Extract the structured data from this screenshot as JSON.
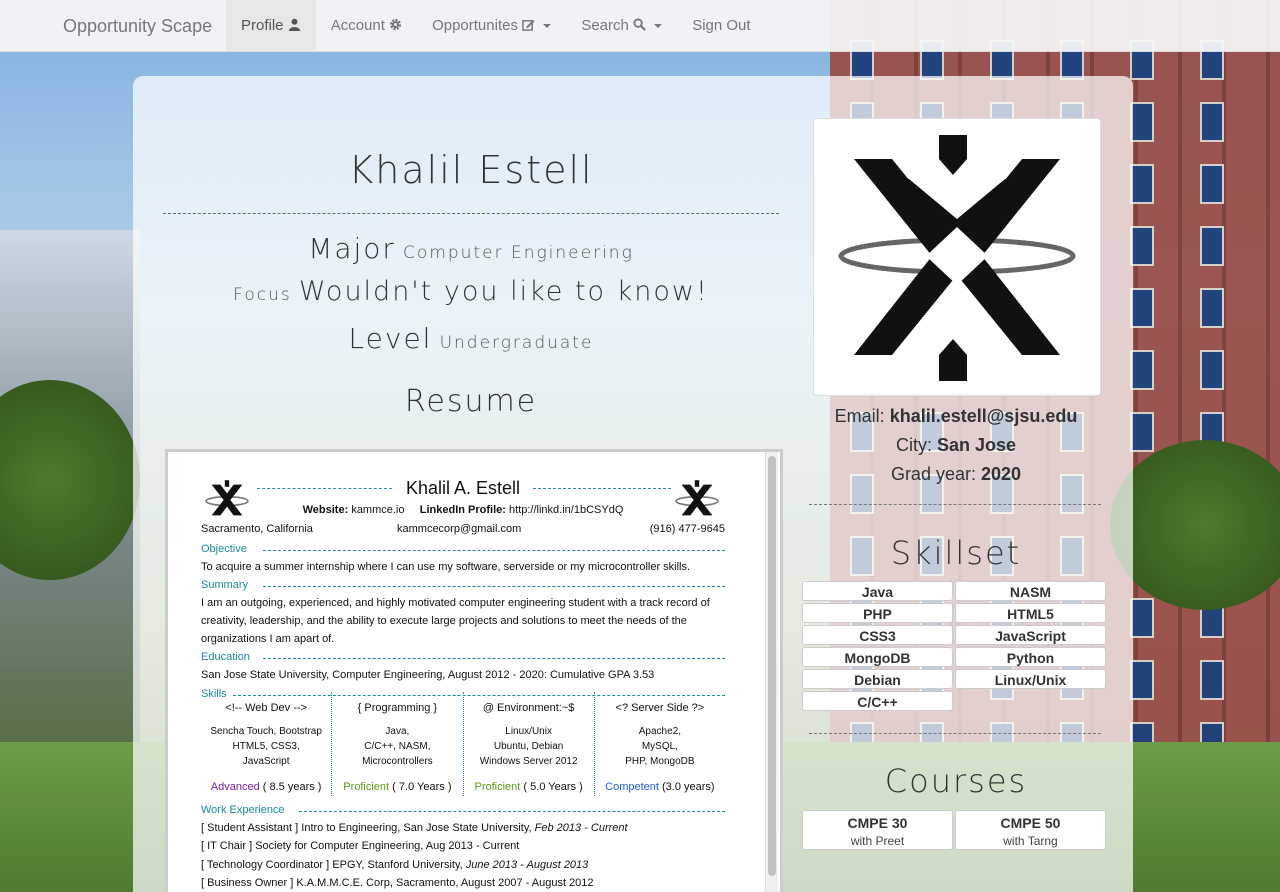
{
  "navbar": {
    "brand": "Opportunity Scape",
    "items": [
      {
        "label": "Profile",
        "icon": "user-icon",
        "active": true
      },
      {
        "label": "Account",
        "icon": "gear-icon"
      },
      {
        "label": "Opportunites",
        "icon": "edit-icon",
        "dropdown": true
      },
      {
        "label": "Search",
        "icon": "search-icon",
        "dropdown": true
      },
      {
        "label": "Sign Out"
      }
    ]
  },
  "profile": {
    "name": "Khalil Estell",
    "major_label": "Major",
    "major_value": "Computer Engineering",
    "focus_label": "Focus",
    "focus_value": "Wouldn't you like to know!",
    "level_label": "Level",
    "level_value": "Undergraduate",
    "resume_title": "Resume"
  },
  "resume": {
    "name": "Khalil A. Estell",
    "website_label": "Website:",
    "website": "kammce.io",
    "linkedin_label": "LinkedIn Profile:",
    "linkedin": "http://linkd.in/1bCSYdQ",
    "location": "Sacramento, California",
    "email": "kammcecorp@gmail.com",
    "phone": "(916) 477-9645",
    "objective_title": "Objective",
    "objective": "To acquire a summer internship where I can use my software, serverside or my microcontroller skills.",
    "summary_title": "Summary",
    "summary": "I am an outgoing, experienced, and highly motivated computer engineering student with a track record of creativity, leadership, and the ability to execute large projects and solutions to meet the needs of the organizations I am apart of.",
    "education_title": "Education",
    "education": "San Jose State University, Computer Engineering, August 2012 - 2020: Cumulative GPA 3.53",
    "skills_title": "Skills",
    "skill_columns": [
      {
        "head": "<!-- Web Dev -->",
        "items": [
          "Sencha Touch, Bootstrap",
          "HTML5, CSS3,",
          "JavaScript"
        ],
        "level": "Advanced",
        "years": "( 8.5 years )",
        "color": "#7a1fa0"
      },
      {
        "head": "{ Programming }",
        "items": [
          "Java,",
          "C/C++, NASM,",
          "Microcontrollers"
        ],
        "level": "Proficient",
        "years": "( 7.0 Years )",
        "color": "#5a9a1a"
      },
      {
        "head": "@ Environment:~$",
        "items": [
          "Linux/Unix",
          "Ubuntu, Debian",
          "Windows Server 2012"
        ],
        "level": "Proficient",
        "years": "( 5.0 Years )",
        "color": "#5a9a1a"
      },
      {
        "head": "<? Server Side ?>",
        "items": [
          "Apache2,",
          "MySQL,",
          "PHP, MongoDB"
        ],
        "level": "Competent",
        "years": "(3.0 years)",
        "color": "#1f5fd0"
      }
    ],
    "work_title": "Work Experience",
    "work": [
      {
        "role": "[ Student Assistant ]",
        "desc": " Intro to Engineering, San Jose State University, ",
        "dates": "Feb 2013 - Current"
      },
      {
        "role": "[ IT Chair ]",
        "desc": " Society for Computer Engineering, Aug 2013 - Current",
        "dates": ""
      },
      {
        "role": "[ Technology Coordinator ]",
        "desc": " EPGY, Stanford University, ",
        "dates": "June 2013 - August 2013"
      },
      {
        "role": "[ Business Owner ]",
        "desc": " K.A.M.M.C.E. Corp, Sacramento, August 2007 - August 2012",
        "dates": ""
      }
    ]
  },
  "sidebar": {
    "email_label": "Email:",
    "email": "khalil.estell@sjsu.edu",
    "city_label": "City:",
    "city": "San Jose",
    "grad_label": "Grad year:",
    "grad": "2020",
    "skillset_title": "Skillset",
    "skills": [
      "Java",
      "NASM",
      "PHP",
      "HTML5",
      "CSS3",
      "JavaScript",
      "MongoDB",
      "Python",
      "Debian",
      "Linux/Unix",
      "C/C++"
    ],
    "courses_title": "Courses",
    "courses": [
      {
        "code": "CMPE 30",
        "teacher": "with Preet"
      },
      {
        "code": "CMPE 50",
        "teacher": "with Tarng"
      }
    ]
  }
}
